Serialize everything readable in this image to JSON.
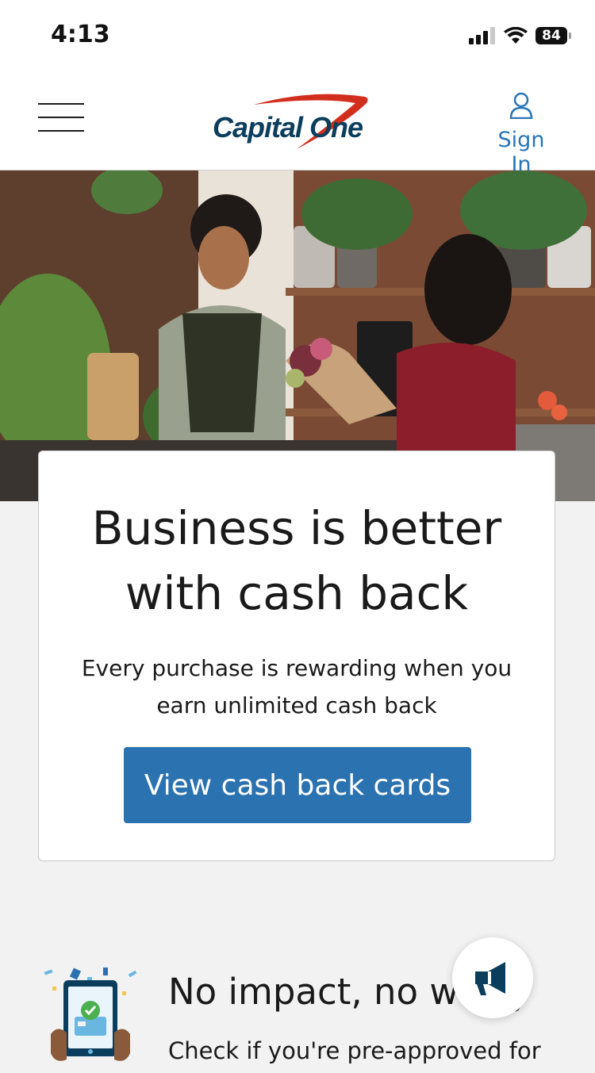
{
  "status_bar": {
    "time": "4:13",
    "battery": "84",
    "icons": [
      "cellular-signal-icon",
      "wifi-icon",
      "battery-icon"
    ]
  },
  "header": {
    "logo_text": "Capital One",
    "sign_in_label": "Sign In",
    "menu_icon": "hamburger-menu-icon",
    "user_icon": "user-icon"
  },
  "hero": {
    "image": "florist shop — smiling employee handing a bouquet to a customer at the counter"
  },
  "promo": {
    "title": "Business is better with cash back",
    "subtitle": "Every purchase is rewarding when you earn unlimited cash back",
    "cta_label": "View cash back cards"
  },
  "feature": {
    "title": "No impact, no worry",
    "description": "Check if you're pre-approved for",
    "icon": "phone-approval-icon"
  },
  "feedback": {
    "icon": "megaphone-icon"
  },
  "colors": {
    "brand_blue": "#2b72b0",
    "logo_navy": "#0b3e5c",
    "logo_swoosh": "#d22e1e",
    "link_blue": "#2a75b5"
  }
}
